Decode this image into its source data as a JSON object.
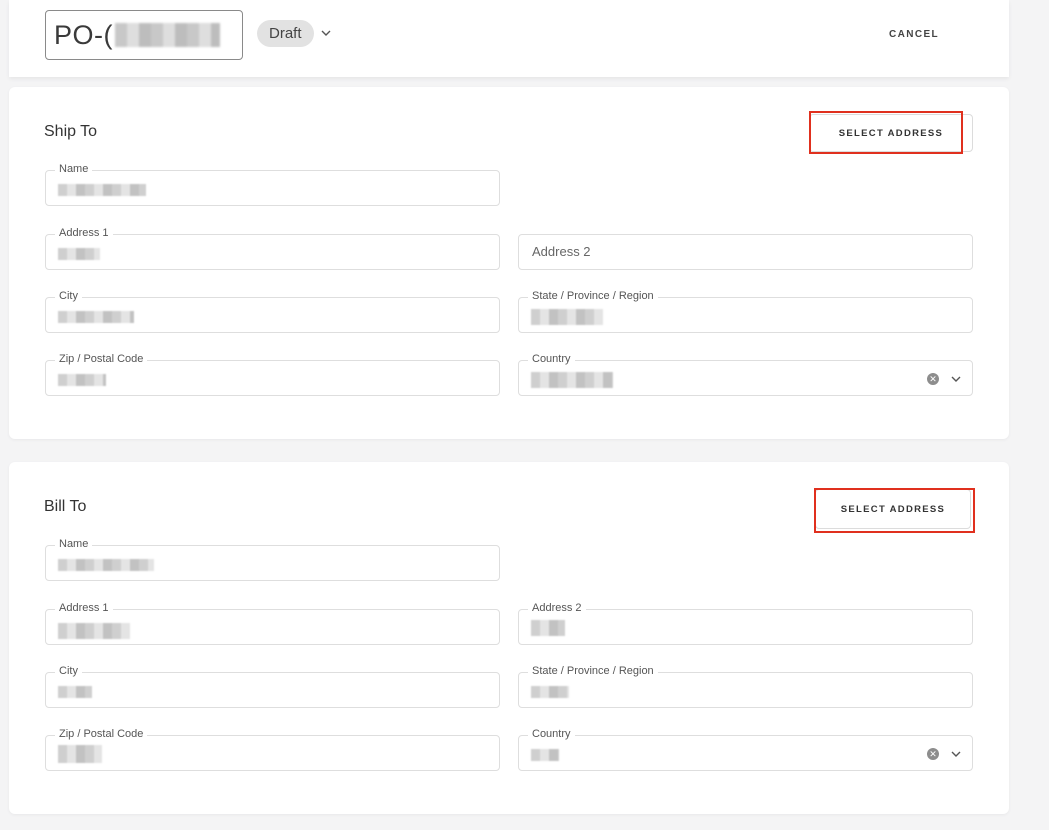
{
  "header": {
    "po_prefix": "PO-(",
    "status": "Draft",
    "cancel_label": "CANCEL"
  },
  "ship_to": {
    "title": "Ship To",
    "select_label": "SELECT ADDRESS",
    "name_label": "Name",
    "address1_label": "Address 1",
    "address2_placeholder": "Address 2",
    "city_label": "City",
    "state_label": "State / Province / Region",
    "zip_label": "Zip / Postal Code",
    "country_label": "Country"
  },
  "bill_to": {
    "title": "Bill To",
    "select_label": "SELECT ADDRESS",
    "name_label": "Name",
    "address1_label": "Address 1",
    "address2_label": "Address 2",
    "city_label": "City",
    "state_label": "State / Province / Region",
    "zip_label": "Zip / Postal Code",
    "country_label": "Country"
  },
  "colors": {
    "highlight": "#e0301e",
    "background": "#f4f4f5"
  }
}
